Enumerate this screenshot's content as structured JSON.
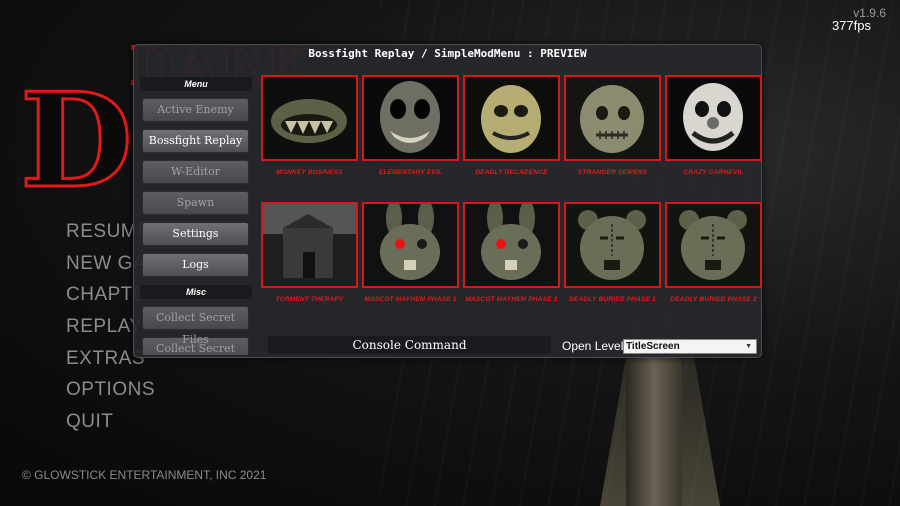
{
  "version": "v1.9.6",
  "fps": "377fps",
  "main_menu": [
    "RESUME",
    "NEW GAME",
    "CHAPTER",
    "REPLAY",
    "EXTRAS",
    "OPTIONS",
    "QUIT"
  ],
  "copyright": "© GLOWSTICK ENTERTAINMENT, INC 2021",
  "mod_window": {
    "title": "Bossfight Replay / SimpleModMenu : PREVIEW",
    "menu_header": "Menu",
    "menu_items": [
      {
        "label": "Active Enemy",
        "enabled": false
      },
      {
        "label": "Bossfight Replay",
        "enabled": true
      },
      {
        "label": "W-Editor",
        "enabled": false
      },
      {
        "label": "Spawn",
        "enabled": false
      },
      {
        "label": "Settings",
        "enabled": true
      },
      {
        "label": "Logs",
        "enabled": true
      }
    ],
    "misc_header": "Misc",
    "misc_items": [
      {
        "label": "Collect Secret Files",
        "enabled": false
      },
      {
        "label": "Collect Secret Files",
        "enabled": false
      }
    ],
    "bossfights": [
      {
        "label": "MONKEY BUSINESS",
        "icon": "monkey-mask-icon"
      },
      {
        "label": "ELEMENTARY EVIL",
        "icon": "ghoul-face-icon"
      },
      {
        "label": "DEADLY DECADENCE",
        "icon": "gold-mask-icon"
      },
      {
        "label": "STRANGER SEWERS",
        "icon": "stitched-mask-icon"
      },
      {
        "label": "CRAZY CARNEVIL",
        "icon": "clown-face-icon"
      },
      {
        "label": "TORMENT THERAPY",
        "icon": "building-icon"
      },
      {
        "label": "MASCOT MAYHEM PHASE 1",
        "icon": "rabbit-mascot-icon"
      },
      {
        "label": "MASCOT MAYHEM PHASE 2",
        "icon": "rabbit-mascot-icon"
      },
      {
        "label": "DEADLY BURIED PHASE 1",
        "icon": "teddy-bear-icon"
      },
      {
        "label": "DEADLY BURIED PHASE 2",
        "icon": "teddy-bear-icon"
      }
    ],
    "console_label": "Console Command",
    "open_level_label": "Open Level:",
    "open_level_value": "TitleScreen"
  },
  "colors": {
    "accent_red": "#d21a1a",
    "panel": "#26282c"
  }
}
